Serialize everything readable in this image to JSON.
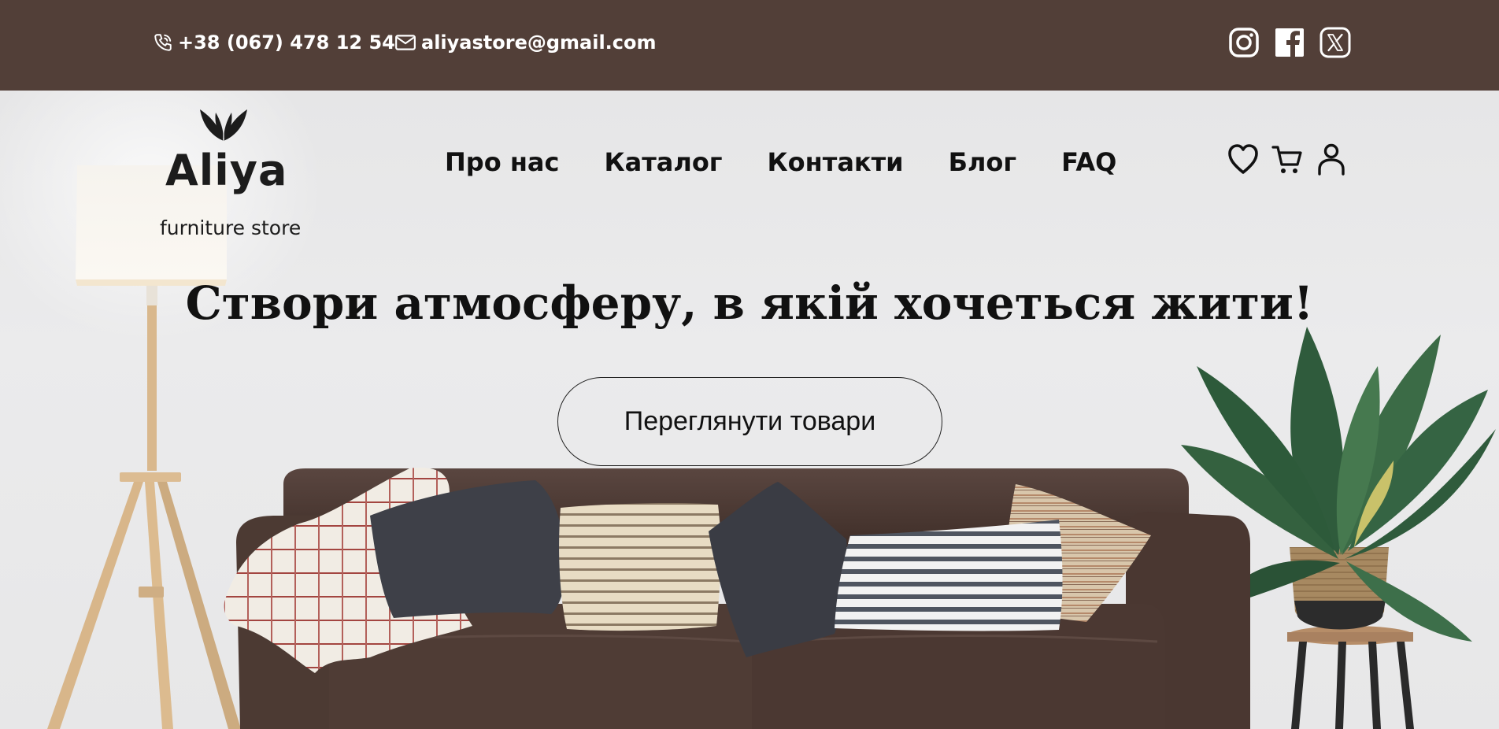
{
  "topbar": {
    "phone": "+38 (067) 478 12 54",
    "email": "aliyastore@gmail.com",
    "socials": [
      "instagram-icon",
      "facebook-icon",
      "x-icon"
    ]
  },
  "logo": {
    "name": "Aliya",
    "subtitle": "furniture store"
  },
  "nav": {
    "items": [
      {
        "label": "Про нас"
      },
      {
        "label": "Каталог"
      },
      {
        "label": "Контакти"
      },
      {
        "label": "Блог"
      },
      {
        "label": "FAQ"
      }
    ]
  },
  "user_icons": [
    "heart-icon",
    "cart-icon",
    "user-icon"
  ],
  "hero": {
    "headline": "Створи атмосферу, в якій хочеться жити!",
    "cta_label": "Переглянути товари"
  },
  "colors": {
    "topbar_bg": "#523f38",
    "sofa": "#4e3a33",
    "background": "#e9e9ea"
  }
}
